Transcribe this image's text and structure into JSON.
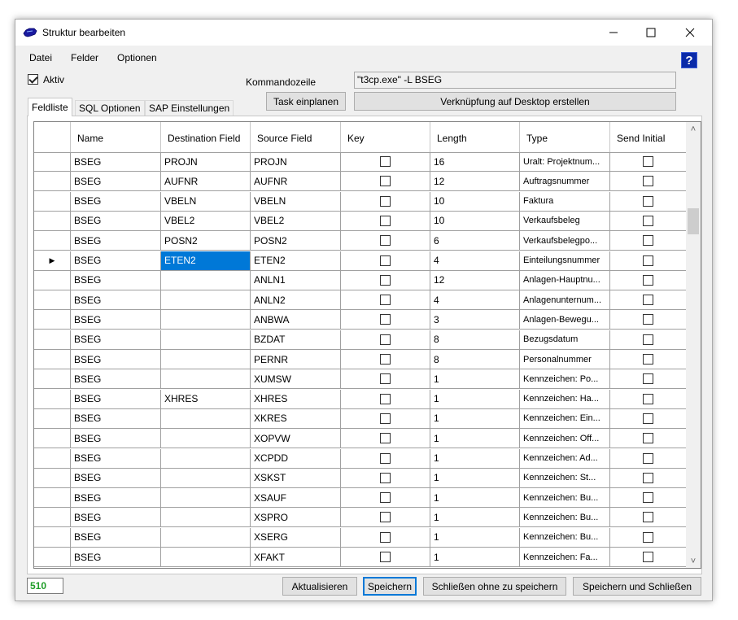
{
  "window": {
    "title": "Struktur bearbeiten"
  },
  "menu": [
    "Datei",
    "Felder",
    "Optionen"
  ],
  "aktiv": {
    "label": "Aktiv",
    "checked": true
  },
  "command": {
    "label": "Kommandozeile",
    "value": "\"t3cp.exe\" -L BSEG"
  },
  "buttons": {
    "schedule": "Task einplanen",
    "shortcut": "Verknüpfung auf Desktop erstellen",
    "refresh": "Aktualisieren",
    "save": "Speichern",
    "close_nosave": "Schließen ohne zu speichern",
    "save_close": "Speichern und Schließen"
  },
  "tabs": [
    "Feldliste",
    "SQL Optionen",
    "SAP Einstellungen"
  ],
  "grid": {
    "headers": [
      "Name",
      "Destination Field",
      "Source Field",
      "Key",
      "Length",
      "Type",
      "Send Initial"
    ],
    "rows": [
      {
        "name": "BSEG",
        "dest": "PROJN",
        "source": "PROJN",
        "length": "16",
        "type": "Uralt: Projektnum..."
      },
      {
        "name": "BSEG",
        "dest": "AUFNR",
        "source": "AUFNR",
        "length": "12",
        "type": "Auftragsnummer"
      },
      {
        "name": "BSEG",
        "dest": "VBELN",
        "source": "VBELN",
        "length": "10",
        "type": "Faktura"
      },
      {
        "name": "BSEG",
        "dest": "VBEL2",
        "source": "VBEL2",
        "length": "10",
        "type": "Verkaufsbeleg"
      },
      {
        "name": "BSEG",
        "dest": "POSN2",
        "source": "POSN2",
        "length": "6",
        "type": "Verkaufsbelegpo..."
      },
      {
        "name": "BSEG",
        "dest": "ETEN2",
        "source": "ETEN2",
        "length": "4",
        "type": "Einteilungsnummer"
      },
      {
        "name": "BSEG",
        "dest": "",
        "source": "ANLN1",
        "length": "12",
        "type": "Anlagen-Hauptnu..."
      },
      {
        "name": "BSEG",
        "dest": "",
        "source": "ANLN2",
        "length": "4",
        "type": "Anlagenunternum..."
      },
      {
        "name": "BSEG",
        "dest": "",
        "source": "ANBWA",
        "length": "3",
        "type": "Anlagen-Bewegu..."
      },
      {
        "name": "BSEG",
        "dest": "",
        "source": "BZDAT",
        "length": "8",
        "type": "Bezugsdatum"
      },
      {
        "name": "BSEG",
        "dest": "",
        "source": "PERNR",
        "length": "8",
        "type": "Personalnummer"
      },
      {
        "name": "BSEG",
        "dest": "",
        "source": "XUMSW",
        "length": "1",
        "type": "Kennzeichen: Po..."
      },
      {
        "name": "BSEG",
        "dest": "XHRES",
        "source": "XHRES",
        "length": "1",
        "type": "Kennzeichen: Ha..."
      },
      {
        "name": "BSEG",
        "dest": "",
        "source": "XKRES",
        "length": "1",
        "type": "Kennzeichen: Ein..."
      },
      {
        "name": "BSEG",
        "dest": "",
        "source": "XOPVW",
        "length": "1",
        "type": "Kennzeichen: Off..."
      },
      {
        "name": "BSEG",
        "dest": "",
        "source": "XCPDD",
        "length": "1",
        "type": "Kennzeichen: Ad..."
      },
      {
        "name": "BSEG",
        "dest": "",
        "source": "XSKST",
        "length": "1",
        "type": "Kennzeichen: St..."
      },
      {
        "name": "BSEG",
        "dest": "",
        "source": "XSAUF",
        "length": "1",
        "type": "Kennzeichen: Bu..."
      },
      {
        "name": "BSEG",
        "dest": "",
        "source": "XSPRO",
        "length": "1",
        "type": "Kennzeichen: Bu..."
      },
      {
        "name": "BSEG",
        "dest": "",
        "source": "XSERG",
        "length": "1",
        "type": "Kennzeichen: Bu..."
      },
      {
        "name": "BSEG",
        "dest": "",
        "source": "XFAKT",
        "length": "1",
        "type": "Kennzeichen: Fa..."
      }
    ],
    "current_row": 5
  },
  "record_count": "510",
  "colors": {
    "accent": "#0078d7",
    "count": "#1f9d28",
    "help": "#0a2aa8"
  }
}
